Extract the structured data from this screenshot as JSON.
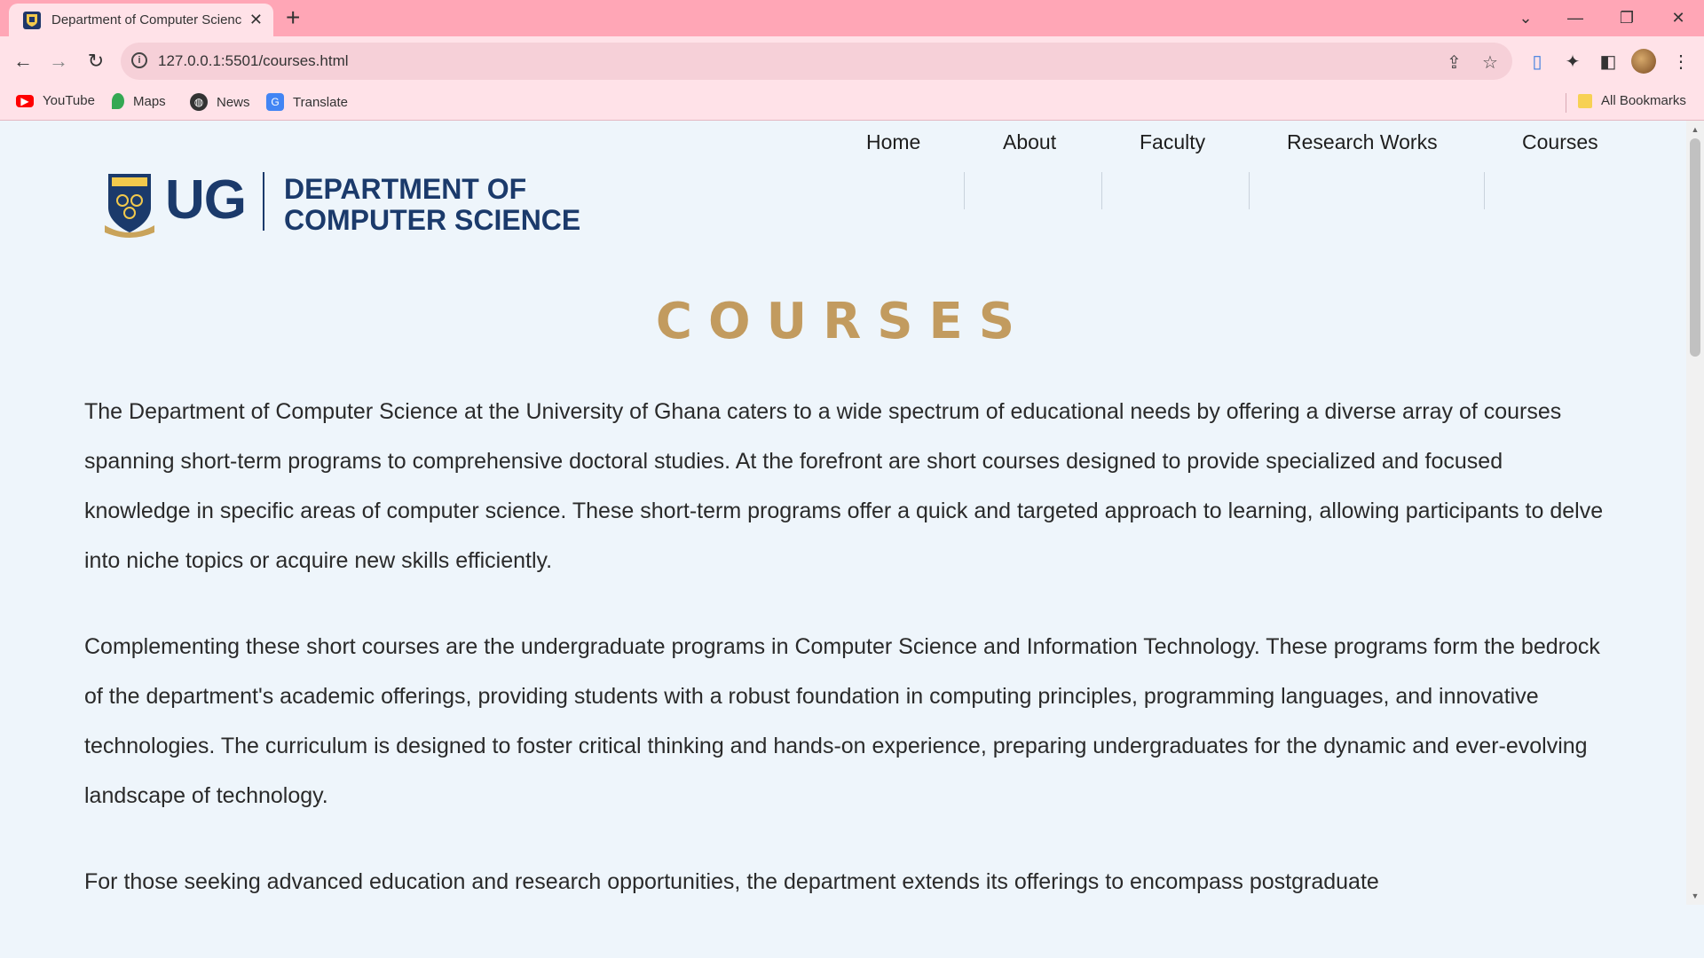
{
  "browser": {
    "tab_title": "Department of Computer Science",
    "url": "127.0.0.1:5501/courses.html",
    "bookmarks": [
      {
        "label": "YouTube",
        "icon": "youtube-icon",
        "color": "#ff0000"
      },
      {
        "label": "Maps",
        "icon": "maps-icon",
        "color": "#34a853"
      },
      {
        "label": "News",
        "icon": "news-icon",
        "color": "#333333"
      },
      {
        "label": "Translate",
        "icon": "translate-icon",
        "color": "#4285f4"
      }
    ],
    "all_bookmarks_label": "All Bookmarks",
    "colors": {
      "tabbar": "#ffa6b6",
      "toolbar": "#ffe2e8"
    }
  },
  "site": {
    "logo_ug": "UG",
    "logo_dept": "DEPARTMENT OF\nCOMPUTER SCIENCE",
    "nav": [
      "Home",
      "About",
      "Faculty",
      "Research Works",
      "Courses"
    ],
    "colors": {
      "brand": "#1b3a6b",
      "heading": "#c29b5f",
      "background": "#eef5fb"
    }
  },
  "main": {
    "heading": "COURSES",
    "paragraphs": [
      "The Department of Computer Science at the University of Ghana caters to a wide spectrum of educational needs by offering a diverse array of courses spanning short-term programs to comprehensive doctoral studies. At the forefront are short courses designed to provide specialized and focused knowledge in specific areas of computer science. These short-term programs offer a quick and targeted approach to learning, allowing participants to delve into niche topics or acquire new skills efficiently.",
      "Complementing these short courses are the undergraduate programs in Computer Science and Information Technology. These programs form the bedrock of the department's academic offerings, providing students with a robust foundation in computing principles, programming languages, and innovative technologies. The curriculum is designed to foster critical thinking and hands-on experience, preparing undergraduates for the dynamic and ever-evolving landscape of technology.",
      "For those seeking advanced education and research opportunities, the department extends its offerings to encompass postgraduate"
    ]
  }
}
